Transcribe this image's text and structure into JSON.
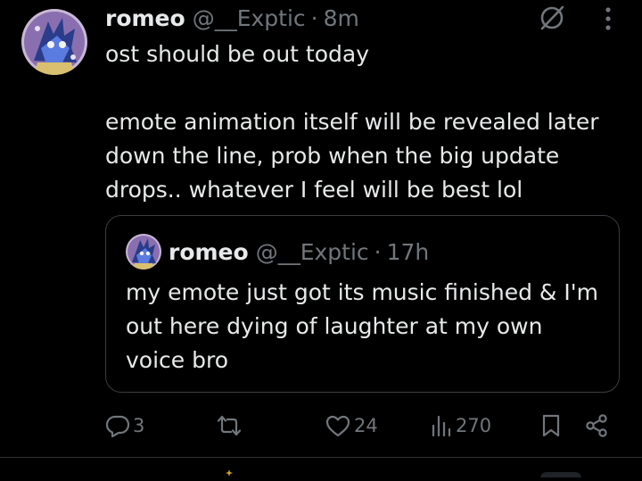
{
  "post": {
    "display_name": "romeo",
    "handle": "@__Exptic",
    "separator": "·",
    "time": "8m",
    "text": "ost should be out today\n\nemote animation itself will be revealed later down the line, prob when the big update drops.. whatever I feel will be best lol",
    "icons": {
      "grok": "grok-slash-icon",
      "more": "more-vertical-icon"
    }
  },
  "quoted_post": {
    "display_name": "romeo",
    "handle": "@__Exptic",
    "separator": "·",
    "time": "17h",
    "text": "my emote just got its music finished & I'm out here dying of laughter at my own voice bro"
  },
  "actions": {
    "reply_count": "3",
    "repost_count": "",
    "like_count": "24",
    "views_count": "270",
    "icons": [
      "reply-icon",
      "repost-icon",
      "like-icon",
      "views-icon",
      "bookmark-icon",
      "share-icon"
    ]
  },
  "colors": {
    "background": "#000000",
    "primary_text": "#e7e9ea",
    "secondary_text": "#71767b",
    "border": "#3a3d41"
  }
}
